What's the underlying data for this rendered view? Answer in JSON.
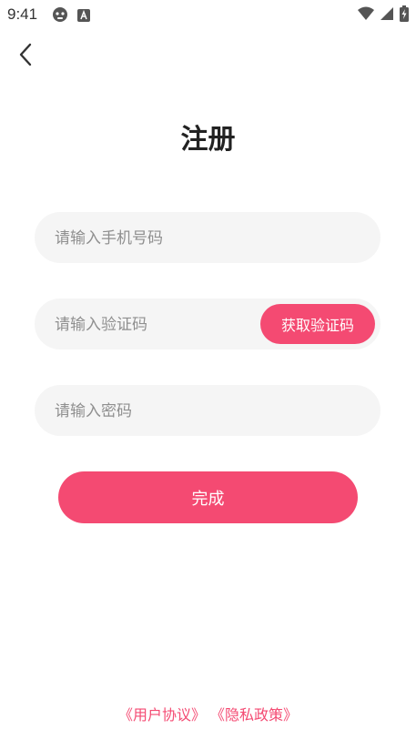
{
  "status_bar": {
    "time": "9:41",
    "left_icons": [
      "game-controller-icon",
      "a-badge-icon"
    ],
    "right_icons": [
      "wifi-icon",
      "signal-icon",
      "battery-charging-icon"
    ]
  },
  "header": {
    "back_icon": "chevron-left-icon",
    "title": "注册"
  },
  "form": {
    "phone_placeholder": "请输入手机号码",
    "code_placeholder": "请输入验证码",
    "get_code_label": "获取验证码",
    "password_placeholder": "请输入密码",
    "submit_label": "完成"
  },
  "footer": {
    "user_agreement": "《用户协议》",
    "privacy_policy": "《隐私政策》"
  },
  "colors": {
    "accent": "#f44a72",
    "field_bg": "#f5f5f5",
    "placeholder": "#8f8f8f"
  }
}
